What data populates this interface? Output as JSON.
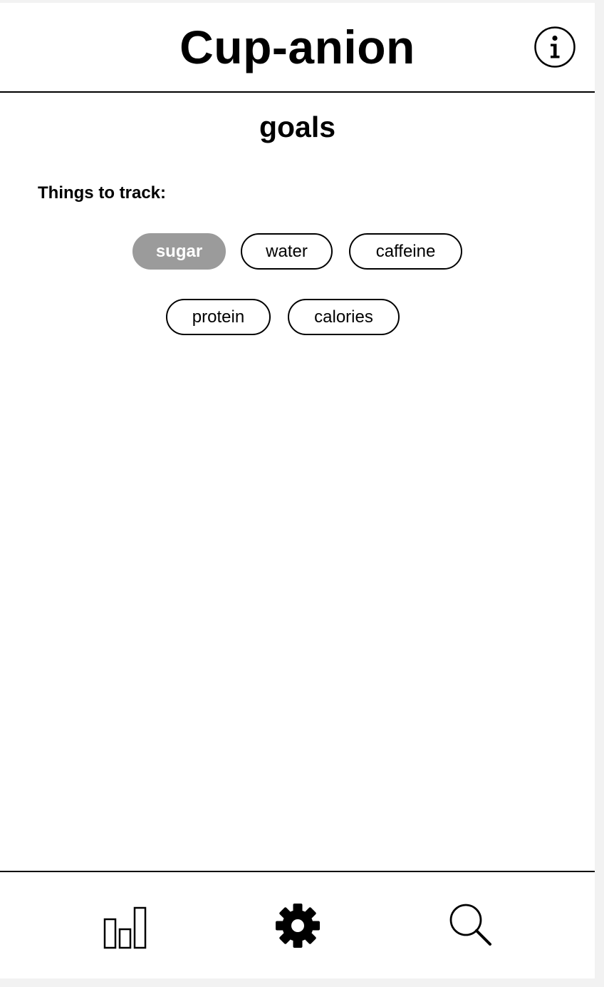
{
  "header": {
    "title": "Cup-anion",
    "info_icon": "info-icon"
  },
  "page": {
    "title": "goals",
    "section_label": "Things to track:"
  },
  "tracking_options": [
    {
      "label": "sugar",
      "selected": true
    },
    {
      "label": "water",
      "selected": false
    },
    {
      "label": "caffeine",
      "selected": false
    },
    {
      "label": "protein",
      "selected": false
    },
    {
      "label": "calories",
      "selected": false
    }
  ],
  "bottom_nav": {
    "items": [
      {
        "icon": "bar-chart-icon",
        "active": false
      },
      {
        "icon": "gear-icon",
        "active": true
      },
      {
        "icon": "search-icon",
        "active": false
      }
    ]
  },
  "colors": {
    "selected_chip": "#9b9b9b",
    "border": "#000000",
    "background": "#ffffff"
  }
}
